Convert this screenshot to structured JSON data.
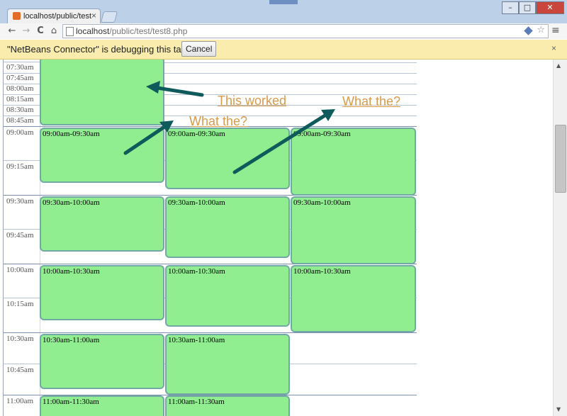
{
  "browser": {
    "tab_title": "localhost/public/test",
    "tab_close": "×",
    "window_controls": {
      "minimize": "–",
      "maximize": "□",
      "close": "✕"
    },
    "nav": {
      "back": "←",
      "forward": "→",
      "reload": "C",
      "home": "⌂"
    },
    "url_host": "localhost",
    "url_path": "/public/test/test8.php",
    "star": "☆",
    "wrench": "≡"
  },
  "infobar": {
    "message": "\"NetBeans Connector\" is debugging this tab.",
    "cancel_label": "Cancel",
    "close": "×"
  },
  "timeline": {
    "top_labels": [
      "07:30am",
      "07:45am",
      "08:00am",
      "08:15am",
      "08:30am",
      "08:45am"
    ],
    "slots": [
      {
        "label": "09:00am",
        "quarter": "09:15am"
      },
      {
        "label": "09:30am",
        "quarter": "09:45am"
      },
      {
        "label": "10:00am",
        "quarter": "10:15am"
      },
      {
        "label": "10:30am",
        "quarter": "10:45am"
      },
      {
        "label": "11:00am",
        "quarter": ""
      }
    ]
  },
  "events": [
    {
      "label": "09:00am-09:30am"
    },
    {
      "label": "09:00am-09:30am"
    },
    {
      "label": "09:00am-09:30am"
    },
    {
      "label": "09:30am-10:00am"
    },
    {
      "label": "09:30am-10:00am"
    },
    {
      "label": "09:30am-10:00am"
    },
    {
      "label": "10:00am-10:30am"
    },
    {
      "label": "10:00am-10:30am"
    },
    {
      "label": "10:00am-10:30am"
    },
    {
      "label": "10:30am-11:00am"
    },
    {
      "label": "10:30am-11:00am"
    },
    {
      "label": "11:00am-11:30am"
    },
    {
      "label": "11:00am-11:30am"
    }
  ],
  "annotations": {
    "this_worked": "This worked",
    "what_the_1": "What the?",
    "what_the_2": "What the?"
  },
  "colors": {
    "event_fill": "#90ee90",
    "event_border": "#71a9a5",
    "annotation_text": "#d99a4a",
    "arrow": "#0f5a5a",
    "infobar": "#f9ecac"
  }
}
